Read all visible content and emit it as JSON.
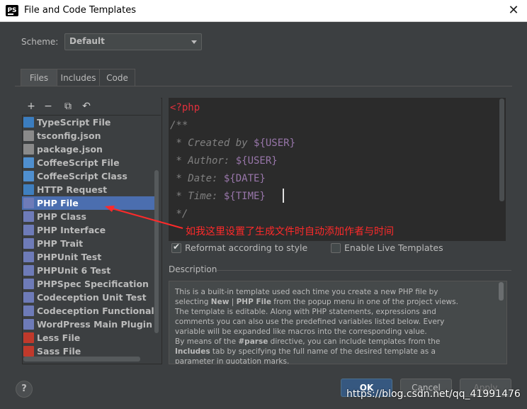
{
  "window": {
    "title": "File and Code Templates",
    "app_icon_text": "PS"
  },
  "scheme": {
    "label": "Scheme:",
    "value": "Default"
  },
  "tabs": [
    {
      "label": "Files",
      "active": true
    },
    {
      "label": "Includes",
      "active": false
    },
    {
      "label": "Code",
      "active": false
    }
  ],
  "toolbar": {
    "add": "+",
    "remove": "−",
    "copy": "⧉",
    "reset": "↶"
  },
  "templates": [
    {
      "label": "TypeScript File",
      "icon": "ts-file-icon",
      "color": "#3b7dbf"
    },
    {
      "label": "tsconfig.json",
      "icon": "json-file-icon",
      "color": "#8a8a8a"
    },
    {
      "label": "package.json",
      "icon": "json-file-icon",
      "color": "#8a8a8a"
    },
    {
      "label": "CoffeeScript File",
      "icon": "coffee-file-icon",
      "color": "#4f8fcf"
    },
    {
      "label": "CoffeeScript Class",
      "icon": "coffee-file-icon",
      "color": "#4f8fcf"
    },
    {
      "label": "HTTP Request",
      "icon": "api-file-icon",
      "color": "#3f7fbf"
    },
    {
      "label": "PHP File",
      "icon": "php-file-icon",
      "color": "#6e7bb8",
      "selected": true
    },
    {
      "label": "PHP Class",
      "icon": "php-file-icon",
      "color": "#6e7bb8"
    },
    {
      "label": "PHP Interface",
      "icon": "php-file-icon",
      "color": "#6e7bb8"
    },
    {
      "label": "PHP Trait",
      "icon": "php-file-icon",
      "color": "#6e7bb8"
    },
    {
      "label": "PHPUnit Test",
      "icon": "php-file-icon",
      "color": "#6e7bb8"
    },
    {
      "label": "PHPUnit 6 Test",
      "icon": "php-file-icon",
      "color": "#6e7bb8"
    },
    {
      "label": "PHPSpec Specification",
      "icon": "php-file-icon",
      "color": "#6e7bb8"
    },
    {
      "label": "Codeception Unit Test",
      "icon": "php-file-icon",
      "color": "#6e7bb8"
    },
    {
      "label": "Codeception Functional Test",
      "icon": "php-file-icon",
      "color": "#6e7bb8"
    },
    {
      "label": "WordPress Main Plugin File",
      "icon": "php-file-icon",
      "color": "#6e7bb8"
    },
    {
      "label": "Less File",
      "icon": "less-file-icon",
      "color": "#c0392b"
    },
    {
      "label": "Sass File",
      "icon": "sass-file-icon",
      "color": "#c0392b"
    }
  ],
  "editor": {
    "line1": "<?php",
    "line2": "/**",
    "created_prefix": " * Created by ",
    "created_var": "${USER}",
    "author_prefix": " * Author: ",
    "author_var": "${USER}",
    "date_prefix": " * Date: ",
    "date_var": "${DATE}",
    "time_prefix": " * Time: ",
    "time_var": "${TIME}",
    "line_end": " */"
  },
  "annotation": "如我这里设置了生成文件时自动添加作者与时间",
  "options": {
    "reformat_label": "Reformat according to style",
    "reformat_checked": true,
    "live_templates_label": "Enable Live Templates",
    "live_templates_checked": false
  },
  "description": {
    "title": "Description",
    "p1_a": "This is a built-in template used each time you create a new PHP file by selecting ",
    "p1_new": "New",
    "p1_sep": " | ",
    "p1_php": "PHP File",
    "p1_b": " from the popup menu in one of the project views. The template is editable. Along with PHP statements, expressions and comments you can also use the predefined variables listed below. Every variable will be expanded like macros into the corresponding value.",
    "p2_a": "By means of the ",
    "p2_parse": "#parse",
    "p2_b": " directive, you can include templates from the ",
    "p2_includes": "Includes",
    "p2_c": " tab by specifying the full name of the desired template as a parameter in quotation marks."
  },
  "buttons": {
    "help": "?",
    "ok": "OK",
    "cancel": "Cancel",
    "apply": "Apply"
  },
  "watermark": "https://blog.csdn.net/qq_41991476"
}
